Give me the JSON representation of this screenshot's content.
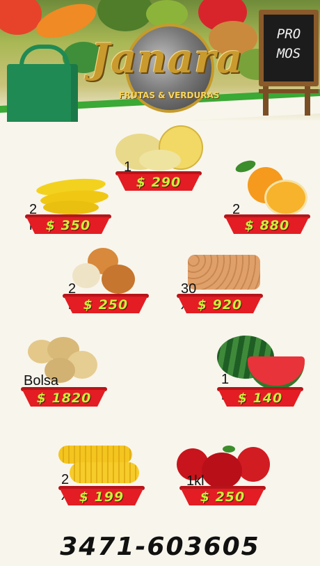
{
  "header": {
    "brand": "Janara",
    "subtitle": "FRUTAS & VERDURAS",
    "promo_board": "PRO\nMOS"
  },
  "products": [
    {
      "name": "melon-item",
      "quantity": "1 kl",
      "price": "$ 290"
    },
    {
      "name": "banana-item",
      "quantity": "2 kl",
      "price": "$ 350"
    },
    {
      "name": "orange-item",
      "quantity": "2 kl",
      "price": "$ 880"
    },
    {
      "name": "onion-item",
      "quantity": "2 kl",
      "price": "$ 250"
    },
    {
      "name": "eggs-item",
      "quantity": "30 x",
      "price": "$ 920"
    },
    {
      "name": "potato-item",
      "quantity": "Bolsa",
      "price": "$ 1820"
    },
    {
      "name": "watermelon-item",
      "quantity": "1 kl",
      "price": "$ 140"
    },
    {
      "name": "corn-item",
      "quantity": "2 x",
      "price": "$ 199"
    },
    {
      "name": "apple-item",
      "quantity": "1kl",
      "price": "$ 250"
    }
  ],
  "footer": {
    "phone": "3471-603605"
  },
  "colors": {
    "tray": "#e31d23",
    "price": "#c8f03a",
    "accent": "#3aa935"
  }
}
